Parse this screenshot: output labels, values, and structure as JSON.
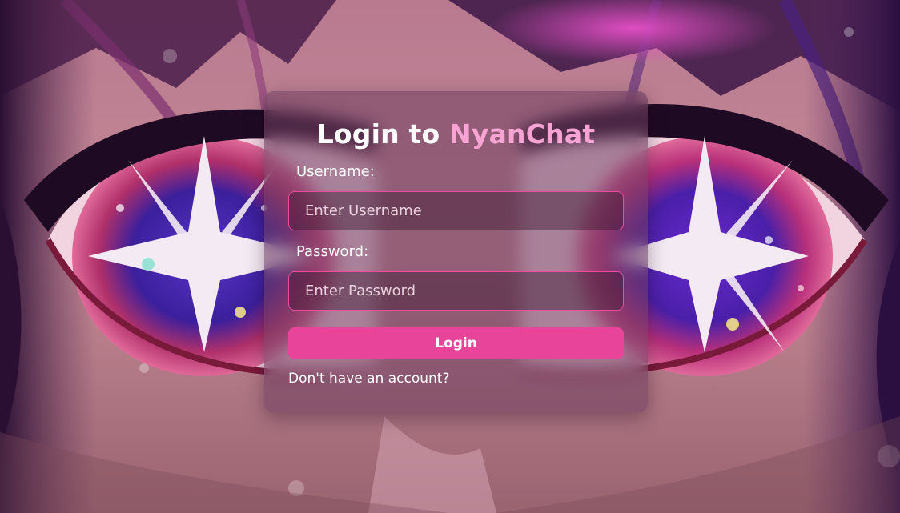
{
  "login": {
    "title_prefix": "Login to ",
    "brand": "NyanChat",
    "username_label": "Username:",
    "username_placeholder": "Enter Username",
    "password_label": "Password:",
    "password_placeholder": "Enter Password",
    "submit_label": "Login",
    "signup_link": "Don't have an account?"
  },
  "colors": {
    "accent": "#e8449a",
    "brand": "#f7a3d4",
    "field_border": "#ec4c9f"
  }
}
